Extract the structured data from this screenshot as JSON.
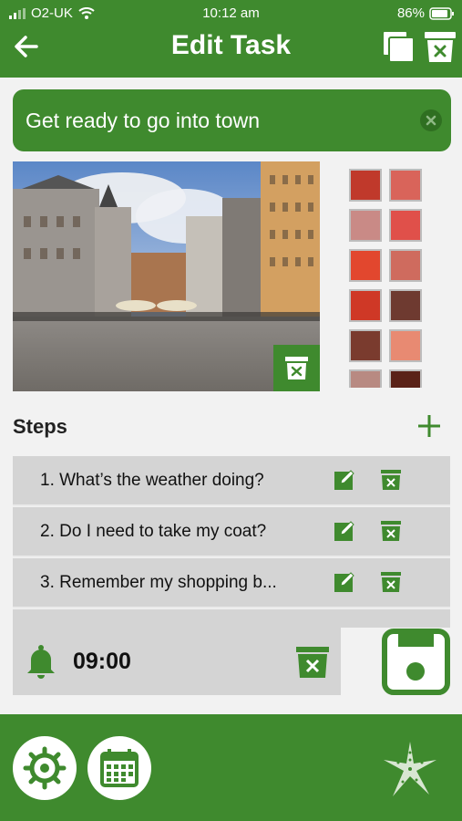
{
  "status": {
    "carrier": "O2-UK",
    "time": "10:12 am",
    "battery": "86%"
  },
  "header": {
    "title": "Edit Task"
  },
  "task": {
    "name": "Get ready to go into town"
  },
  "colors": {
    "brand": "#3f8a2e",
    "swatches": [
      "#c0392b",
      "#d9645a",
      "#c98a86",
      "#e0504a",
      "#e2472e",
      "#cf6b5e",
      "#cf3826",
      "#6e3a30",
      "#7a3b2e",
      "#e88a72",
      "#b88a82",
      "#5a2218"
    ]
  },
  "steps": {
    "title": "Steps",
    "items": [
      {
        "label": "1.  What’s the weather doing?"
      },
      {
        "label": "2.  Do I need to take my coat?"
      },
      {
        "label": "3.  Remember my shopping b..."
      }
    ]
  },
  "alarm": {
    "time": "09:00"
  }
}
